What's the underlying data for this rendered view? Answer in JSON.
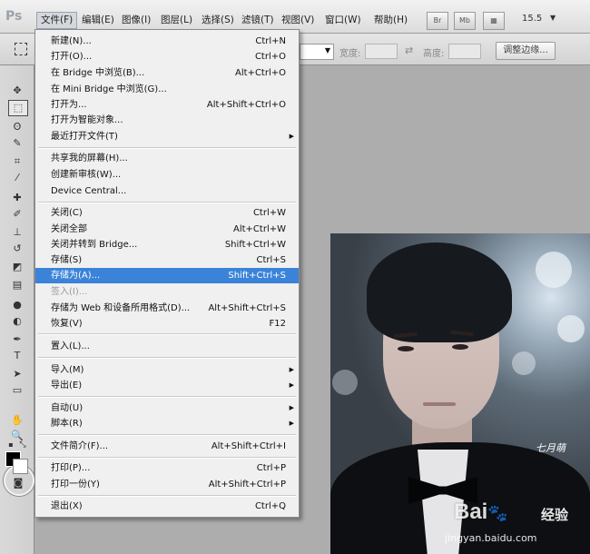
{
  "app": {
    "logo": "Ps"
  },
  "menubar": {
    "items": [
      "文件(F)",
      "编辑(E)",
      "图像(I)",
      "图层(L)",
      "选择(S)",
      "滤镜(T)",
      "视图(V)",
      "窗口(W)",
      "帮助(H)"
    ],
    "btn_br": "Br",
    "btn_mb": "Mb",
    "zoom": "15.5"
  },
  "optbar": {
    "width_label": "宽度:",
    "height_label": "高度:",
    "refine_label": "调整边缘..."
  },
  "menu": {
    "items": [
      {
        "label": "新建(N)...",
        "shortcut": "Ctrl+N"
      },
      {
        "label": "打开(O)...",
        "shortcut": "Ctrl+O"
      },
      {
        "label": "在 Bridge 中浏览(B)...",
        "shortcut": "Alt+Ctrl+O"
      },
      {
        "label": "在 Mini Bridge 中浏览(G)...",
        "shortcut": ""
      },
      {
        "label": "打开为...",
        "shortcut": "Alt+Shift+Ctrl+O"
      },
      {
        "label": "打开为智能对象...",
        "shortcut": ""
      },
      {
        "label": "最近打开文件(T)",
        "shortcut": ""
      },
      {
        "label": "共享我的屏幕(H)...",
        "shortcut": ""
      },
      {
        "label": "创建新审核(W)...",
        "shortcut": ""
      },
      {
        "label": "Device Central...",
        "shortcut": ""
      },
      {
        "label": "关闭(C)",
        "shortcut": "Ctrl+W"
      },
      {
        "label": "关闭全部",
        "shortcut": "Alt+Ctrl+W"
      },
      {
        "label": "关闭并转到 Bridge...",
        "shortcut": "Shift+Ctrl+W"
      },
      {
        "label": "存储(S)",
        "shortcut": "Ctrl+S"
      },
      {
        "label": "存储为(A)...",
        "shortcut": "Shift+Ctrl+S"
      },
      {
        "label": "签入(I)...",
        "shortcut": ""
      },
      {
        "label": "存储为 Web 和设备所用格式(D)...",
        "shortcut": "Alt+Shift+Ctrl+S"
      },
      {
        "label": "恢复(V)",
        "shortcut": "F12"
      },
      {
        "label": "置入(L)...",
        "shortcut": ""
      },
      {
        "label": "导入(M)",
        "shortcut": ""
      },
      {
        "label": "导出(E)",
        "shortcut": ""
      },
      {
        "label": "自动(U)",
        "shortcut": ""
      },
      {
        "label": "脚本(R)",
        "shortcut": ""
      },
      {
        "label": "文件简介(F)...",
        "shortcut": "Alt+Shift+Ctrl+I"
      },
      {
        "label": "打印(P)...",
        "shortcut": "Ctrl+P"
      },
      {
        "label": "打印一份(Y)",
        "shortcut": "Alt+Shift+Ctrl+P"
      },
      {
        "label": "退出(X)",
        "shortcut": "Ctrl+Q"
      }
    ],
    "highlighted": "存储为(A)...",
    "disabled": [
      "签入(I)..."
    ]
  },
  "photo": {
    "signature": "七月萌",
    "watermark_brand": "Bai",
    "watermark_paw": "🐾",
    "watermark_cn": "经验",
    "watermark_url": "jingyan.baidu.com"
  },
  "colors": {
    "highlight": "#3b83d8",
    "menu_bg": "#f0f0f0"
  }
}
